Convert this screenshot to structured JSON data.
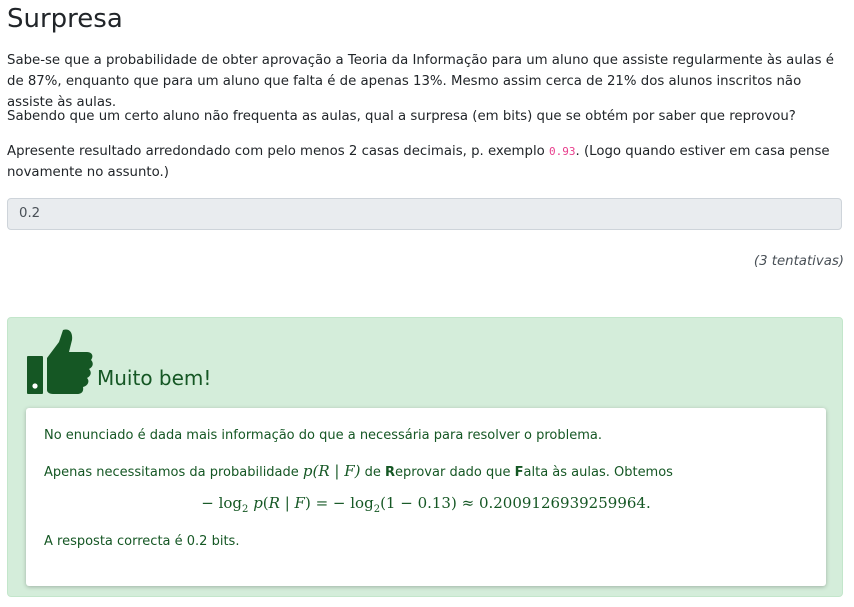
{
  "question": {
    "title": "Surpresa",
    "p1": "Sabe-se que a probabilidade de obter aprovação a Teoria da Informação para um aluno que assiste regularmente às aulas é de 87%, enquanto que para um aluno que falta é de apenas 13%. Mesmo assim cerca de 21% dos alunos inscritos não assiste às aulas.",
    "p2": "Sabendo que um certo aluno não frequenta as aulas, qual a surpresa (em bits) que se obtém por saber que reprovou?",
    "p3_before": "Apresente resultado arredondado com pelo menos 2 casas decimais, p. exemplo ",
    "p3_code": "0.93",
    "p3_after": ". (Logo quando estiver em casa pense novamente no assunto.)"
  },
  "answer": {
    "value": "0.2"
  },
  "attempts_text": "(3 tentativas)",
  "feedback": {
    "icon": "thumbs-up-icon",
    "heading": "Muito bem!",
    "line1": "No enunciado é dada mais informação do que a necessária para resolver o problema.",
    "line2_a": "Apenas necessitamos da probabilidade ",
    "line2_math": "p(R | F)",
    "line2_b": " de ",
    "line2_R": "R",
    "line2_c": "eprovar dado que ",
    "line2_F": "F",
    "line2_d": "alta às aulas. Obtemos",
    "formula_result": "0.2009126939259964",
    "answer_line": "A resposta correcta é 0.2 bits."
  },
  "colors": {
    "success_bg": "#d4edda",
    "success_text": "#155724",
    "code": "#e83e8c"
  }
}
